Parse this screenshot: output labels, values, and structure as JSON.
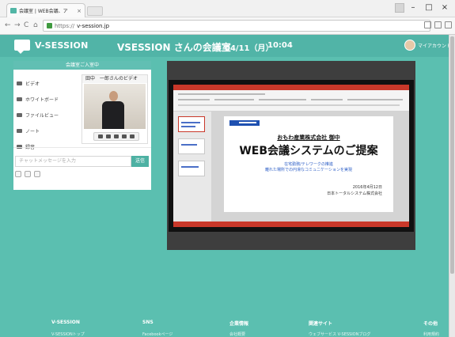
{
  "browser": {
    "tab_title": "会議室 | WEB会議、ア",
    "tab_close": "×",
    "url_prefix": "https://",
    "url_host": "v-session.jp",
    "window_buttons": [
      "–",
      "□",
      "×"
    ]
  },
  "header": {
    "logo": "V-SESSION",
    "room_title": "VSESSION さんの会議室",
    "date": "04/11（月）",
    "time": "10:04",
    "account": "マイアカウント"
  },
  "left_panel": {
    "title": "会議室ご入室中",
    "menu": [
      {
        "label": "ビデオ",
        "icon": "video-icon"
      },
      {
        "label": "ホワイトボード",
        "icon": "whiteboard-icon"
      },
      {
        "label": "ファイルビュー",
        "icon": "file-icon"
      },
      {
        "label": "ノート",
        "icon": "note-icon"
      },
      {
        "label": "録音",
        "icon": "record-icon"
      }
    ],
    "video_label": "田中　一郎さんのビデオ",
    "chat_placeholder": "チャットメッセージを入力",
    "chat_send": "送信"
  },
  "slide": {
    "company": "おもわ産業株式会社 御中",
    "headline": "WEB会議システムのご提案",
    "sub1": "在宅勤務/テレワークの推進",
    "sub2": "離れた場所での円滑なコミュニケーションを実現",
    "date": "2016年4月12日",
    "by": "日本トータルシステム株式会社"
  },
  "footer": {
    "columns": [
      "V-SESSION",
      "SNS",
      "企業情報",
      "関連サイト",
      "その他"
    ],
    "links": [
      "V-SESSIONトップ",
      "Facebookページ",
      "会社概要",
      "ウェブサービス V-SESSIONブログ",
      "利用規約"
    ]
  }
}
